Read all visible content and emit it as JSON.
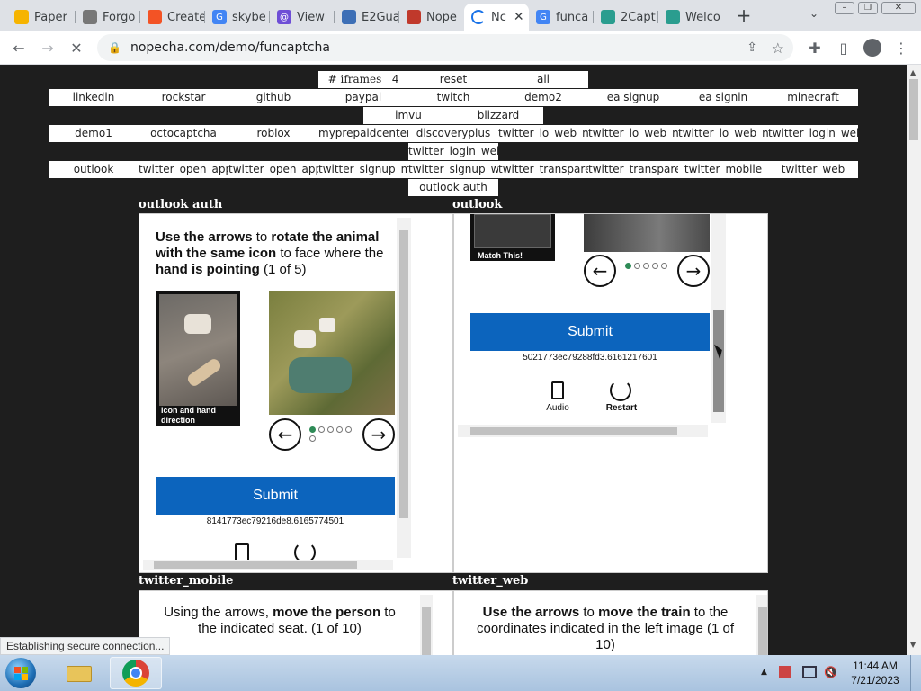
{
  "browser": {
    "tabs": [
      {
        "label": "Paper",
        "color": "#f6b400"
      },
      {
        "label": "Forgo",
        "color": "#777777"
      },
      {
        "label": "Create",
        "color": "#f35325"
      },
      {
        "label": "skybe",
        "color": "#4285f4"
      },
      {
        "label": "View",
        "color": "#6e4ed6"
      },
      {
        "label": "E2Gua",
        "color": "#3d6fb6"
      },
      {
        "label": "Nope",
        "color": "#c0392b"
      },
      {
        "label": "Nc",
        "color": "#1a73e8"
      },
      {
        "label": "funca",
        "color": "#4285f4"
      },
      {
        "label": "2Capt",
        "color": "#2a9d8f"
      },
      {
        "label": "Welco",
        "color": "#2a9d8f"
      }
    ],
    "url": "nopecha.com/demo/funcaptcha",
    "status": "Establishing secure connection..."
  },
  "nav": {
    "top_row": [
      "# iframes",
      "4",
      "reset",
      "all"
    ],
    "row1": [
      "linkedin",
      "rockstar",
      "github",
      "paypal",
      "twitch",
      "demo2",
      "ea signup",
      "ea signin",
      "minecraft"
    ],
    "row2": [
      "imvu",
      "blizzard"
    ],
    "row3": [
      "demo1",
      "octocaptcha",
      "roblox",
      "myprepaidcenter",
      "discoveryplus",
      "twitter_lo_web_not",
      "twitter_lo_web_not",
      "twitter_lo_web_not",
      "twitter_login_web_"
    ],
    "row4": [
      "twitter_login_web_"
    ],
    "row5": [
      "outlook",
      "twitter_open_app_",
      "twitter_open_app_",
      "twitter_signup_mot",
      "twitter_signup_web",
      "twitter_transparent",
      "twitter_transparent",
      "twitter_mobile",
      "twitter_web"
    ],
    "row6": [
      "outlook auth"
    ]
  },
  "sections": {
    "s1": "outlook auth",
    "s2": "outlook",
    "s3": "twitter_mobile",
    "s4": "twitter_web"
  },
  "captcha1": {
    "instr_b1": "Use the arrows",
    "instr_t1": " to ",
    "instr_b2": "rotate the animal with the same icon",
    "instr_t2": " to face where the ",
    "instr_b3": "hand is pointing",
    "instr_t3": " (1 of 5)",
    "ref_caption": "icon and hand direction",
    "submit": "Submit",
    "token": "8141773ec79216de8.6165774501"
  },
  "captcha2": {
    "match_label": "Match This!",
    "submit": "Submit",
    "token": "5021773ec79288fd3.6161217601",
    "audio": "Audio",
    "restart": "Restart"
  },
  "captcha3": {
    "instr_t1": "Using the arrows, ",
    "instr_b1": "move the person",
    "instr_t2": " to the indicated seat. (1 of 10)"
  },
  "captcha4": {
    "instr_b1": "Use the arrows",
    "instr_t1": " to ",
    "instr_b2": "move the train",
    "instr_t2": " to the coordinates indicated in the left image (1 of 10)"
  },
  "taskbar": {
    "time": "11:44 AM",
    "date": "7/21/2023"
  }
}
